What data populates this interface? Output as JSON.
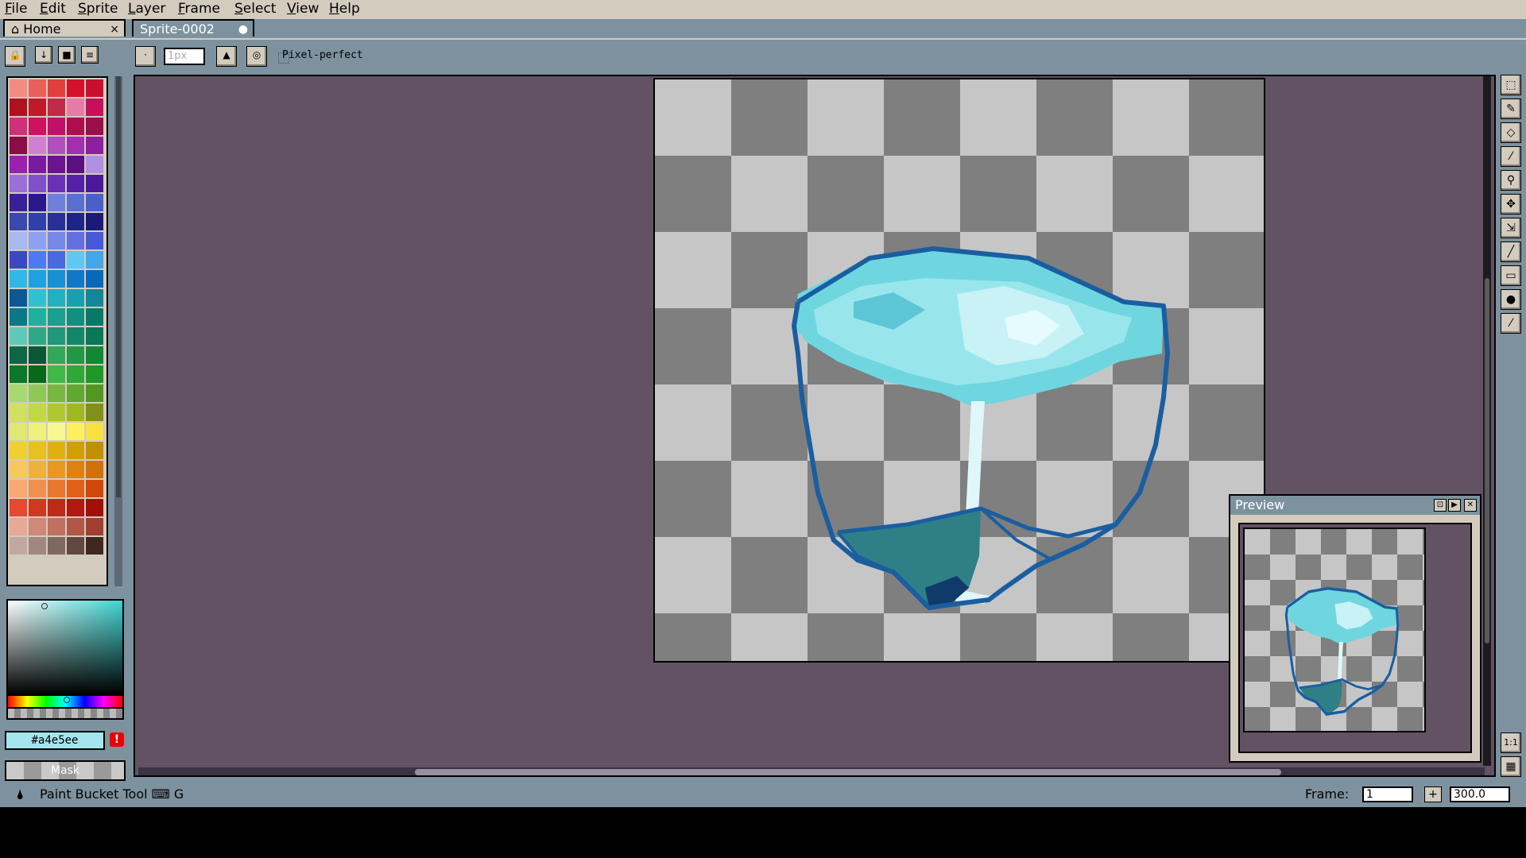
{
  "menubar": {
    "items": [
      {
        "u": "F",
        "rest": "ile"
      },
      {
        "u": "E",
        "rest": "dit"
      },
      {
        "u": "S",
        "rest": "prite"
      },
      {
        "u": "L",
        "rest": "ayer"
      },
      {
        "u": "F",
        "rest": "rame"
      },
      {
        "u": "S",
        "rest": "elect"
      },
      {
        "u": "V",
        "rest": "iew"
      },
      {
        "u": "H",
        "rest": "elp"
      }
    ]
  },
  "tabs": {
    "home": {
      "label": "Home",
      "close": "×"
    },
    "sprite": {
      "label": "Sprite-0002",
      "modified": "●"
    }
  },
  "toolbar": {
    "brush_size_placeholder": "1px",
    "pixel_perfect_label": "Pixel-perfect"
  },
  "color": {
    "hex": "#a4e5ee",
    "warning": "!",
    "mask_label": "Mask",
    "palette": [
      "#f28b82",
      "#e8605b",
      "#e0403d",
      "#d4102a",
      "#c8102e",
      "#b01020",
      "#c01a2a",
      "#c4284a",
      "#e87aa8",
      "#c8105a",
      "#d0307a",
      "#d01060",
      "#c01068",
      "#b00c50",
      "#9a0e4a",
      "#8c0c48",
      "#d080d0",
      "#b050c0",
      "#a030b0",
      "#8c20a0",
      "#9a20b0",
      "#7a1aa0",
      "#6a1490",
      "#5a1080",
      "#b090e0",
      "#9a70d8",
      "#8050c8",
      "#6a30b8",
      "#5420a8",
      "#4a1898",
      "#3a2098",
      "#2a1888",
      "#7080d8",
      "#5a70d0",
      "#4a60c8",
      "#3a48b0",
      "#3040a8",
      "#283098",
      "#1e2488",
      "#1a1a78",
      "#a8b8f0",
      "#90a0f0",
      "#7888e8",
      "#6070e0",
      "#4858d8",
      "#3a48c8",
      "#5078f0",
      "#4a68e0",
      "#60c8f0",
      "#40a8e8",
      "#30b8e8",
      "#20a0e0",
      "#1890d8",
      "#1078c8",
      "#0a68b8",
      "#0a5898",
      "#30c0d0",
      "#20b0c0",
      "#18a0b0",
      "#108898",
      "#0a7888",
      "#20b0a0",
      "#18a090",
      "#109080",
      "#0a7868",
      "#60c8b8",
      "#30a888",
      "#20987a",
      "#108868",
      "#0a7858",
      "#0a6848",
      "#0a5838",
      "#30a858",
      "#209848",
      "#108838",
      "#0a7828",
      "#0a6818",
      "#40b848",
      "#30a838",
      "#209828",
      "#a8d870",
      "#90c858",
      "#78b840",
      "#60a830",
      "#509820",
      "#d0e060",
      "#c0d848",
      "#b0c830",
      "#a0b820",
      "#809018",
      "#e0e870",
      "#f0f080",
      "#f8f890",
      "#fff060",
      "#f8e040",
      "#f0d030",
      "#e8c020",
      "#e0b010",
      "#d0a000",
      "#c09000",
      "#f8c860",
      "#f0b040",
      "#e89820",
      "#e08010",
      "#d07008",
      "#f8a870",
      "#f09050",
      "#e87830",
      "#e06018",
      "#d04808",
      "#e84830",
      "#d03820",
      "#c02818",
      "#b01810",
      "#a01008",
      "#e8a898",
      "#d08878",
      "#c07060",
      "#b05848",
      "#a04030",
      "#c0a8a0",
      "#a08880",
      "#806860",
      "#604840",
      "#402820"
    ]
  },
  "editor": {
    "sprite_title": "Sprite-0002"
  },
  "preview": {
    "title": "Preview"
  },
  "tools": [
    "marquee-icon",
    "pencil-icon",
    "eraser-icon",
    "eyedropper-icon",
    "zoom-icon",
    "move-icon",
    "slice-icon",
    "line-icon",
    "rectangle-icon",
    "contour-icon",
    "blur-icon"
  ],
  "status": {
    "tool_text": "Paint Bucket Tool",
    "shortcut": "G",
    "frame_label": "Frame:",
    "frame_value": "1",
    "add_frame": "+",
    "zoom_value": "300.0"
  },
  "side": {
    "one_to_one": "1:1"
  }
}
